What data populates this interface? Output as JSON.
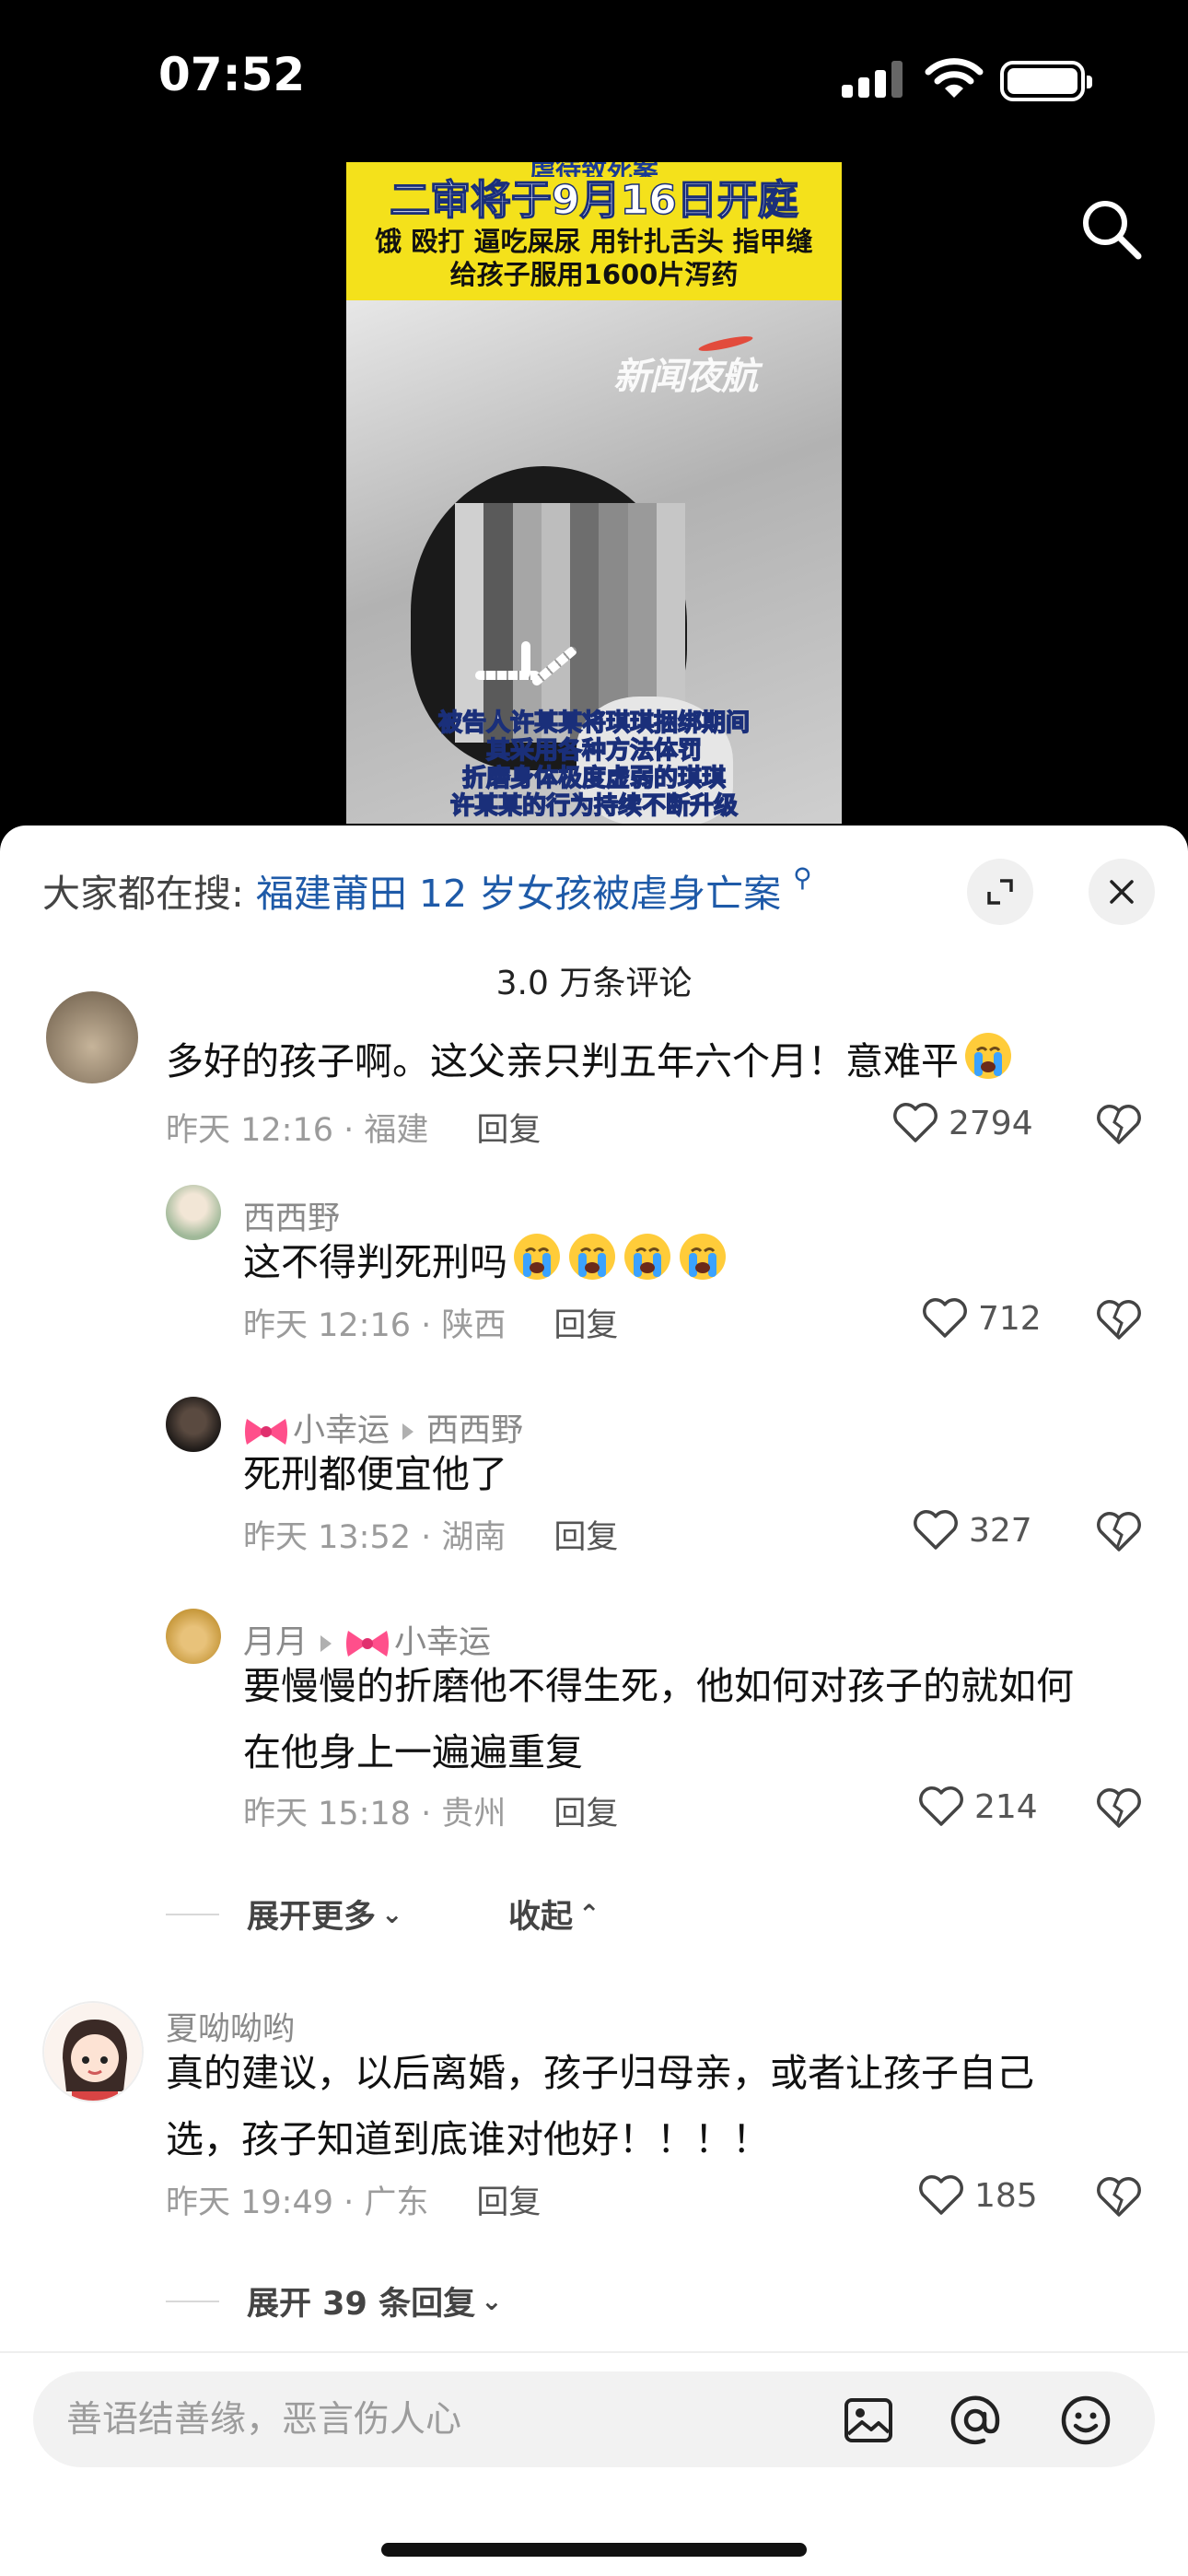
{
  "status_bar": {
    "time": "07:52",
    "battery_level": 1.0,
    "signal_bars_active": 3
  },
  "video": {
    "headline_top": "虐待致死案",
    "headline_main": "二审将于9月16日开庭",
    "headline_sub_1": "饿 殴打 逼吃屎尿 用针扎舌头 指甲缝",
    "headline_sub_2": "给孩子服用1600片泻药",
    "watermark": "新闻夜航",
    "caption": [
      "被告人许某某将琪琪捆绑期间",
      "其采用各种方法体罚",
      "折磨身体极度虚弱的琪琪",
      "许某某的行为持续不断升级"
    ]
  },
  "sheet": {
    "search_prefix": "大家都在搜:",
    "search_term": "福建莆田 12 岁女孩被虐身亡案",
    "comment_count": "3.0 万条评论"
  },
  "reply_label": "回复",
  "comments": [
    {
      "text": "多好的孩子啊。这父亲只判五年六个月！意难平",
      "time_location": "昨天 12:16 · 福建",
      "likes": "2794"
    },
    {
      "author": "西西野",
      "text": "这不得判死刑吗",
      "time_location": "昨天 12:16 · 陕西",
      "likes": "712"
    },
    {
      "author": "小幸运",
      "reply_to": "西西野",
      "text": "死刑都便宜他了",
      "time_location": "昨天 13:52 · 湖南",
      "likes": "327"
    },
    {
      "author": "月月",
      "reply_to": "小幸运",
      "text_lines": [
        "要慢慢的折磨他不得生死，他如何对孩子的就如何",
        "在他身上一遍遍重复"
      ],
      "time_location": "昨天 15:18 · 贵州",
      "likes": "214"
    },
    {
      "author": "夏呦呦哟",
      "text_lines": [
        "真的建议，以后离婚，孩子归母亲，或者让孩子自己",
        "选，孩子知道到底谁对他好！！！！"
      ],
      "time_location": "昨天 19:49 · 广东",
      "likes": "185"
    }
  ],
  "expand_more": "展开更多",
  "collapse": "收起",
  "expand_replies": "展开 39 条回复",
  "input": {
    "placeholder": "善语结善缘，恶言伤人心"
  },
  "colors": {
    "link_blue": "#1e5aa8",
    "headline_yellow": "#f4e11b"
  },
  "icons": [
    "search-icon",
    "expand-icon",
    "close-icon",
    "heart-icon",
    "broken-heart-icon",
    "image-icon",
    "at-icon",
    "emoji-icon",
    "crying-emoji",
    "bow-emoji"
  ]
}
